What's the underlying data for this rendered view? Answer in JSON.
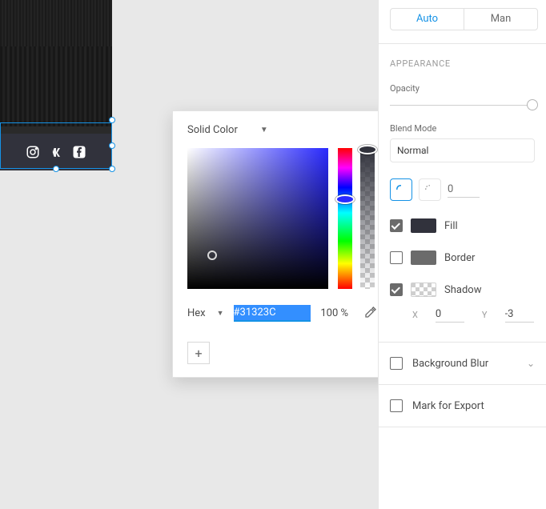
{
  "canvas": {
    "footer_color": "#31323C",
    "icons": [
      "instagram",
      "vk",
      "facebook"
    ]
  },
  "popover": {
    "mode_label": "Solid Color",
    "hex_label": "Hex",
    "hex_value": "#31323C",
    "alpha_value": "100 %"
  },
  "panel": {
    "segmented": {
      "auto": "Auto",
      "manual": "Man"
    },
    "appearance_title": "APPEARANCE",
    "opacity_label": "Opacity",
    "blend_label": "Blend Mode",
    "blend_value": "Normal",
    "corner_radius": "0",
    "fill_label": "Fill",
    "border_label": "Border",
    "shadow_label": "Shadow",
    "xy": {
      "x_label": "X",
      "x_value": "0",
      "y_label": "Y",
      "y_value": "-3"
    },
    "bg_blur_label": "Background Blur",
    "export_label": "Mark for Export"
  }
}
